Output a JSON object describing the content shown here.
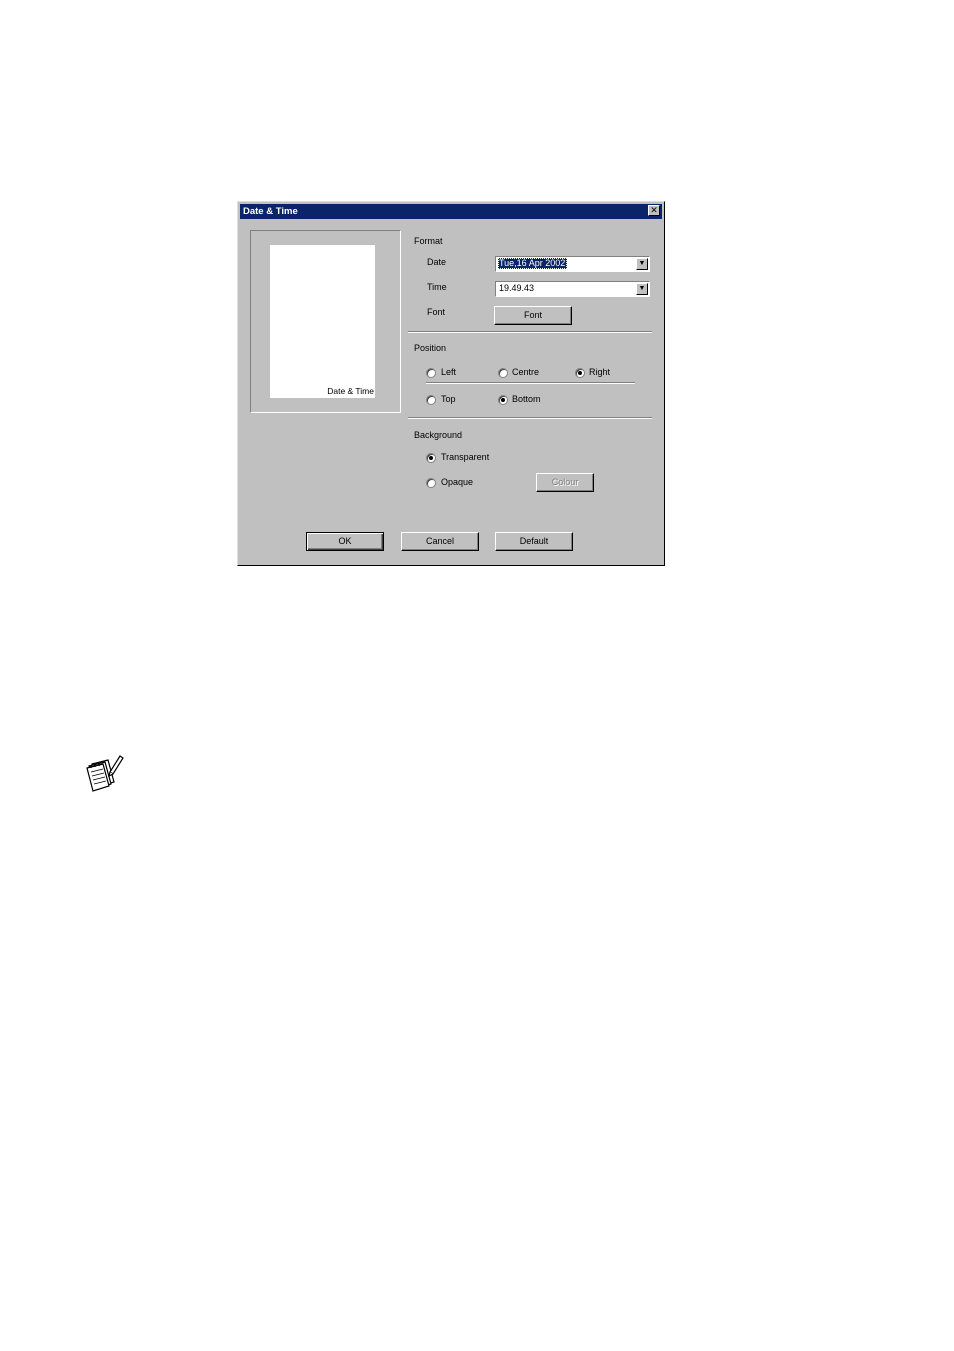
{
  "dialog": {
    "title": "Date & Time",
    "close_symbol": "✕",
    "preview_text": "Date & Time",
    "format": {
      "heading": "Format",
      "date_label": "Date",
      "date_value": "Tue,16 Apr 2002",
      "time_label": "Time",
      "time_value": "19.49.43",
      "font_label": "Font",
      "font_button": "Font"
    },
    "position": {
      "heading": "Position",
      "options_horizontal": [
        "Left",
        "Centre",
        "Right"
      ],
      "selected_horizontal": "Right",
      "options_vertical": [
        "Top",
        "Bottom"
      ],
      "selected_vertical": "Bottom"
    },
    "background": {
      "heading": "Background",
      "transparent_label": "Transparent",
      "opaque_label": "Opaque",
      "selected": "Transparent",
      "colour_button": "Colour"
    },
    "buttons": {
      "ok": "OK",
      "cancel": "Cancel",
      "default": "Default"
    },
    "dropdown_arrow": "▼"
  },
  "colors": {
    "titlebar": "#0a246a",
    "dialog_bg": "#c0c0c0"
  },
  "icons": {
    "note": "note-pad-pencil-icon"
  }
}
